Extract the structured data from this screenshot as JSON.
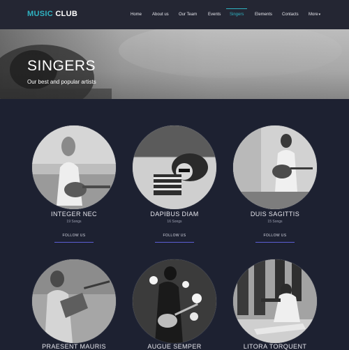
{
  "brand": {
    "part1": "MUSIC",
    "part2": "CLUB",
    "accent_color": "#2fb3c2"
  },
  "nav": {
    "items": [
      {
        "label": "Home"
      },
      {
        "label": "About us"
      },
      {
        "label": "Our Team"
      },
      {
        "label": "Events"
      },
      {
        "label": "Singers",
        "active": true
      },
      {
        "label": "Elements"
      },
      {
        "label": "Contacts"
      },
      {
        "label": "More"
      }
    ],
    "more_caret": "▾"
  },
  "hero": {
    "title": "SINGERS",
    "subtitle": "Our best and popular artists"
  },
  "singers": [
    {
      "name": "INTEGER NEC",
      "songs": "19 Songs",
      "follow": "FOLLOW US",
      "photo": "woman-guitar-field-icon"
    },
    {
      "name": "DAPIBUS DIAM",
      "songs": "16 Songs",
      "follow": "FOLLOW US",
      "photo": "woman-lying-sunglasses-icon"
    },
    {
      "name": "DUIS SAGITTIS",
      "songs": "15 Songs",
      "follow": "FOLLOW US",
      "photo": "woman-guitar-wall-icon"
    },
    {
      "name": "PRAESENT MAURIS",
      "photo": "woman-balalaika-icon"
    },
    {
      "name": "AUGUE SEMPER",
      "photo": "man-guitar-stage-icon"
    },
    {
      "name": "LITORA TORQUENT",
      "photo": "man-trumpet-icon"
    }
  ],
  "colors": {
    "background": "#1d2131",
    "navbar": "#242633",
    "follow_underline": "#5d5fd6"
  }
}
